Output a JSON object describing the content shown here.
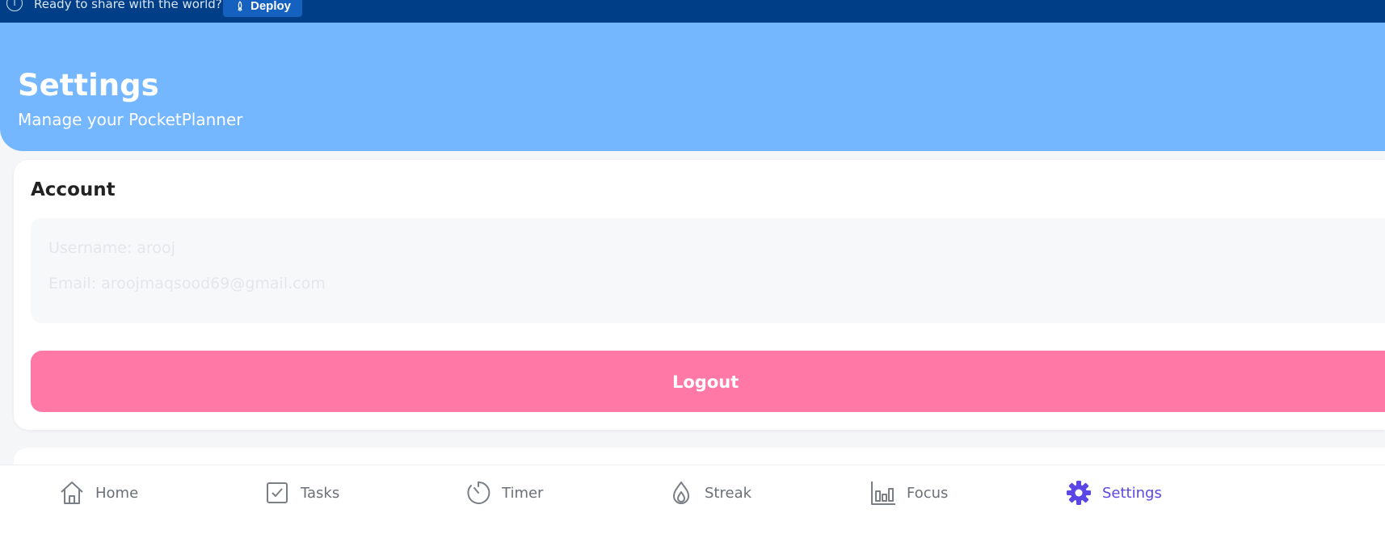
{
  "banner": {
    "message": "Ready to share with the world?",
    "deploy_label": "Deploy"
  },
  "header": {
    "title": "Settings",
    "subtitle": "Manage your PocketPlanner"
  },
  "account": {
    "heading": "Account",
    "username_line": "Username: arooj",
    "email_line": "Email: aroojmaqsood69@gmail.com",
    "logout_label": "Logout"
  },
  "nav": {
    "items": [
      {
        "label": "Home",
        "icon": "home-icon"
      },
      {
        "label": "Tasks",
        "icon": "checkbox-icon"
      },
      {
        "label": "Timer",
        "icon": "timer-icon"
      },
      {
        "label": "Streak",
        "icon": "flame-icon"
      },
      {
        "label": "Focus",
        "icon": "bar-chart-icon"
      },
      {
        "label": "Settings",
        "icon": "gear-icon",
        "active": true
      }
    ]
  },
  "colors": {
    "banner_bg": "#003f87",
    "header_bg": "#74b7ff",
    "logout_bg": "#ff78a6",
    "active_nav": "#5b47e6"
  }
}
